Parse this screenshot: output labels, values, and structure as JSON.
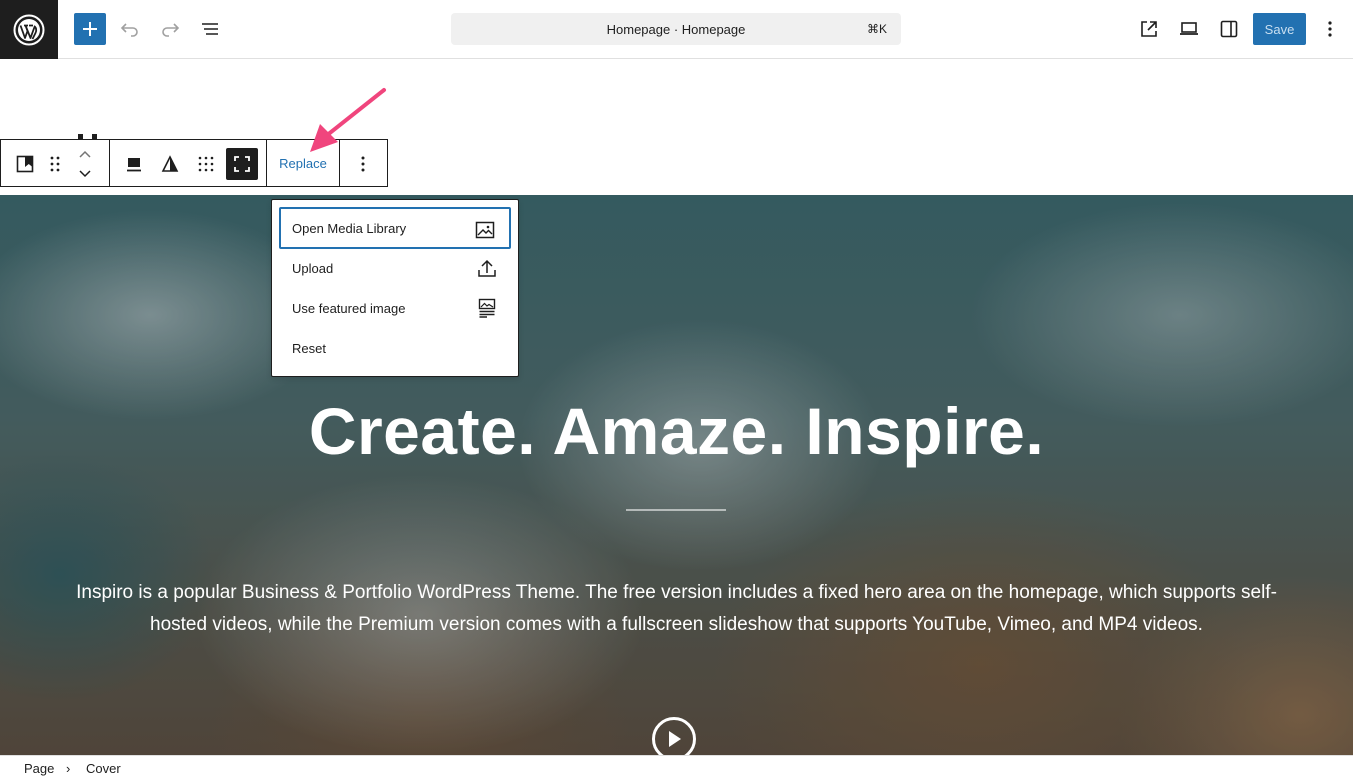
{
  "topbar": {
    "command_title": "Homepage · Homepage",
    "shortcut": "⌘K",
    "save_label": "Save"
  },
  "block_toolbar": {
    "replace_label": "Replace"
  },
  "dropdown": {
    "items": [
      {
        "label": "Open Media Library",
        "icon": "image-icon"
      },
      {
        "label": "Upload",
        "icon": "upload-icon"
      },
      {
        "label": "Use featured image",
        "icon": "featured-image-icon"
      },
      {
        "label": "Reset",
        "icon": ""
      }
    ]
  },
  "cover": {
    "title": "Create. Amaze. Inspire.",
    "description": "Inspiro is a popular Business & Portfolio WordPress Theme. The free version includes a fixed hero area on the homepage, which supports self-hosted videos, while the Premium version comes with a fullscreen slideshow that supports YouTube, Vimeo, and MP4 videos."
  },
  "breadcrumb": {
    "items": [
      "Page",
      "Cover"
    ],
    "separator": "›"
  },
  "colors": {
    "accent": "#2271b1",
    "annotation_arrow": "#f0457d",
    "dark": "#1e1e1e"
  }
}
